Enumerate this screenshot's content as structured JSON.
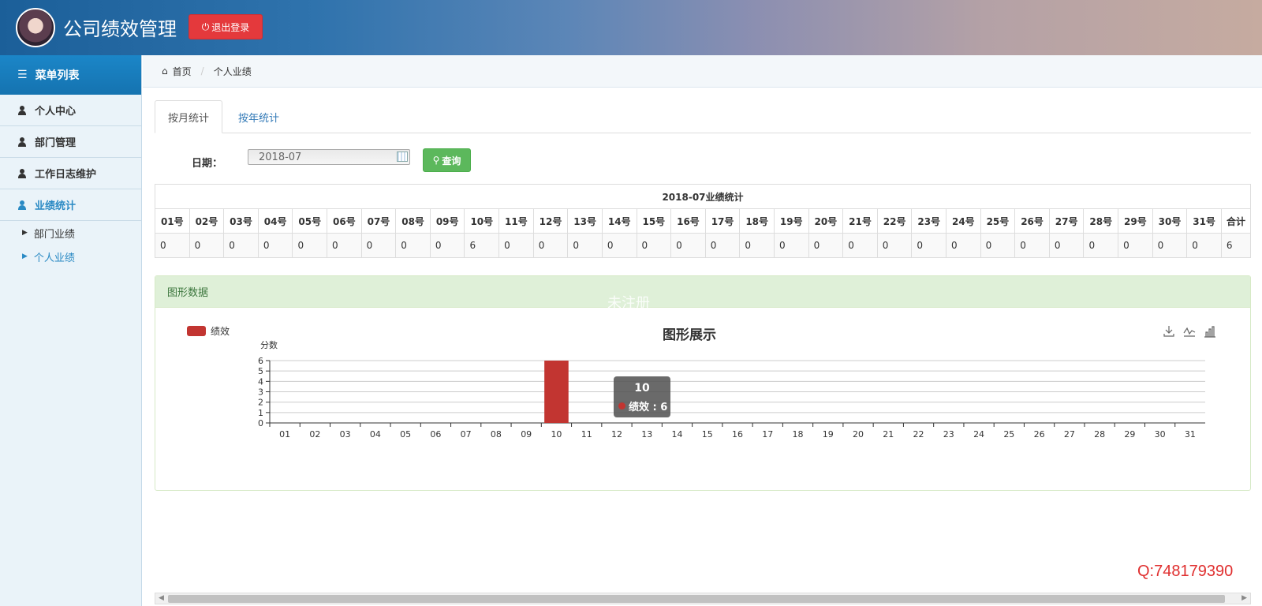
{
  "header": {
    "title": "公司绩效管理",
    "logout_label": "退出登录"
  },
  "sidebar": {
    "heading": "菜单列表",
    "items": [
      {
        "label": "个人中心"
      },
      {
        "label": "部门管理"
      },
      {
        "label": "工作日志维护"
      },
      {
        "label": "业绩统计"
      }
    ],
    "subitems": [
      {
        "label": "部门业绩"
      },
      {
        "label": "个人业绩"
      }
    ]
  },
  "breadcrumb": {
    "home": "首页",
    "current": "个人业绩"
  },
  "tabs": [
    "按月统计",
    "按年统计"
  ],
  "form": {
    "date_label": "日期：",
    "date_value": "2018-07",
    "search_label": "查询"
  },
  "table": {
    "caption": "2018-07业绩统计",
    "headers": [
      "01号",
      "02号",
      "03号",
      "04号",
      "05号",
      "06号",
      "07号",
      "08号",
      "09号",
      "10号",
      "11号",
      "12号",
      "13号",
      "14号",
      "15号",
      "16号",
      "17号",
      "18号",
      "19号",
      "20号",
      "21号",
      "22号",
      "23号",
      "24号",
      "25号",
      "26号",
      "27号",
      "28号",
      "29号",
      "30号",
      "31号",
      "合计"
    ],
    "values": [
      "0",
      "0",
      "0",
      "0",
      "0",
      "0",
      "0",
      "0",
      "0",
      "6",
      "0",
      "0",
      "0",
      "0",
      "0",
      "0",
      "0",
      "0",
      "0",
      "0",
      "0",
      "0",
      "0",
      "0",
      "0",
      "0",
      "0",
      "0",
      "0",
      "0",
      "0",
      "6"
    ]
  },
  "panel": {
    "heading": "图形数据",
    "watermark": "未注册"
  },
  "colors": {
    "accent": "#1573b0",
    "bar": "#c23531",
    "logout": "#e4393c",
    "search": "#5cb85c"
  },
  "chart_data": {
    "type": "bar",
    "title": "图形展示",
    "ylabel": "分数",
    "xlabel": "",
    "ylim": [
      0,
      6
    ],
    "yticks": [
      "0",
      "1",
      "2",
      "3",
      "4",
      "5",
      "6"
    ],
    "categories": [
      "01",
      "02",
      "03",
      "04",
      "05",
      "06",
      "07",
      "08",
      "09",
      "10",
      "11",
      "12",
      "13",
      "14",
      "15",
      "16",
      "17",
      "18",
      "19",
      "20",
      "21",
      "22",
      "23",
      "24",
      "25",
      "26",
      "27",
      "28",
      "29",
      "30",
      "31"
    ],
    "series": [
      {
        "name": "绩效",
        "values": [
          0,
          0,
          0,
          0,
          0,
          0,
          0,
          0,
          0,
          6,
          0,
          0,
          0,
          0,
          0,
          0,
          0,
          0,
          0,
          0,
          0,
          0,
          0,
          0,
          0,
          0,
          0,
          0,
          0,
          0,
          0
        ]
      }
    ],
    "legend": "top-left",
    "grid": true,
    "tooltip": {
      "title": "10",
      "label": "绩效 : 6"
    }
  },
  "footer": {
    "qq": "Q:748179390"
  }
}
